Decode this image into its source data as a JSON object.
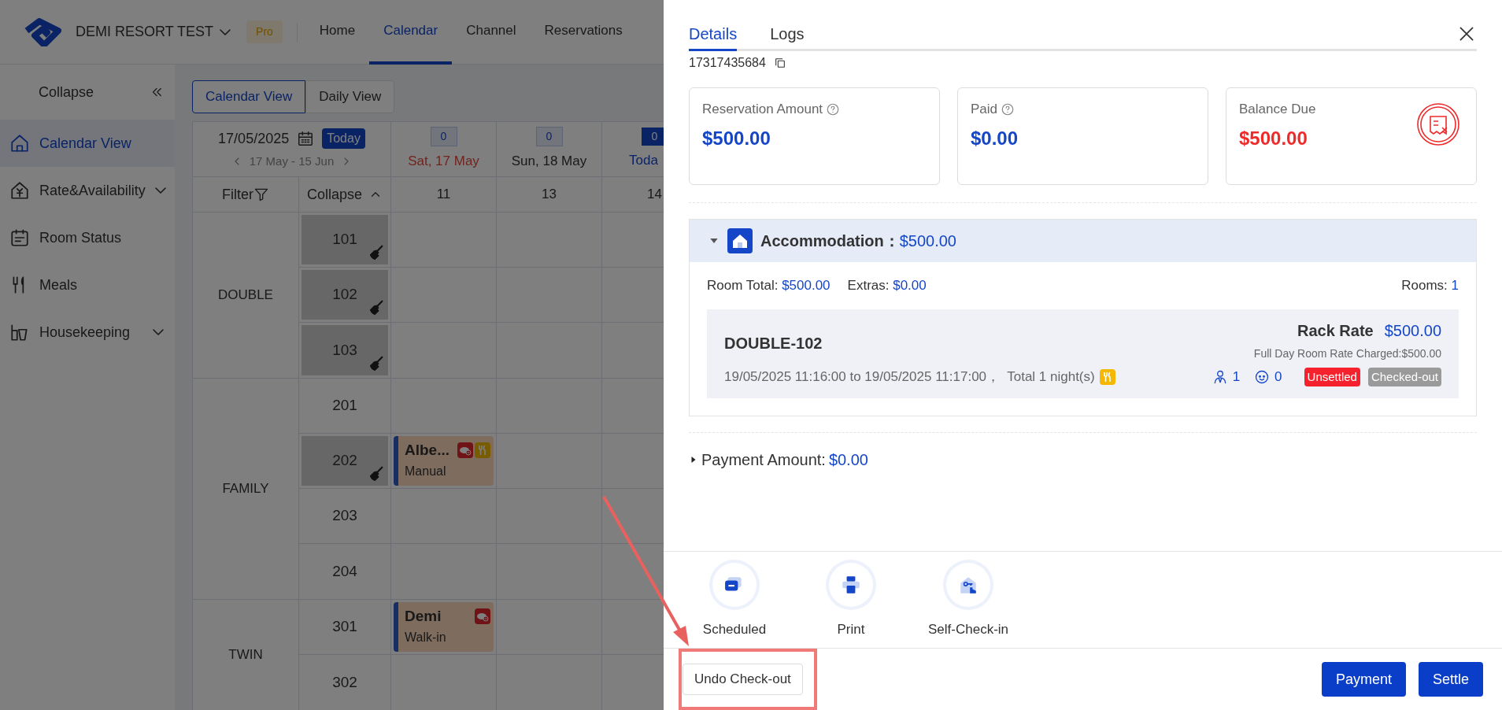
{
  "header": {
    "hotel": "DEMI RESORT TEST",
    "badge": "Pro",
    "nav": [
      {
        "label": "Home",
        "selected": false
      },
      {
        "label": "Calendar",
        "selected": true
      },
      {
        "label": "Channel",
        "selected": false
      },
      {
        "label": "Reservations",
        "selected": false
      }
    ]
  },
  "sidebar": {
    "collapse": "Collapse",
    "items": [
      {
        "label": "Calendar View",
        "selected": true
      },
      {
        "label": "Rate&Availability",
        "selected": false,
        "expandable": true
      },
      {
        "label": "Room Status",
        "selected": false
      },
      {
        "label": "Meals",
        "selected": false
      },
      {
        "label": "Housekeeping",
        "selected": false,
        "expandable": true
      }
    ]
  },
  "view_toggle": [
    {
      "label": "Calendar View",
      "selected": true
    },
    {
      "label": "Daily View",
      "selected": false
    }
  ],
  "calendar": {
    "date": "17/05/2025",
    "today": "Today",
    "range": "17 May - 15 Jun",
    "filter": "Filter",
    "collapse": "Collapse",
    "days": [
      {
        "count": "0",
        "label": "Sat, 17 May",
        "kind": "weekend",
        "available": "11"
      },
      {
        "count": "0",
        "label": "Sun, 18 May",
        "kind": "normal",
        "available": "13"
      },
      {
        "count": "0",
        "label": "Toda",
        "kind": "today",
        "available": "14"
      }
    ],
    "groups": [
      {
        "name": "DOUBLE",
        "rooms": [
          {
            "number": "101",
            "dirty": true
          },
          {
            "number": "102",
            "dirty": true
          },
          {
            "number": "103",
            "dirty": true
          }
        ]
      },
      {
        "name": "FAMILY",
        "rooms": [
          {
            "number": "201",
            "dirty": false
          },
          {
            "number": "202",
            "dirty": true,
            "booking": {
              "guest": "Albe...",
              "source": "Manual",
              "meal": true
            }
          },
          {
            "number": "203",
            "dirty": false
          },
          {
            "number": "204",
            "dirty": false
          }
        ]
      },
      {
        "name": "TWIN",
        "rooms": [
          {
            "number": "301",
            "dirty": false,
            "booking": {
              "guest": "Demi",
              "source": "Walk-in"
            }
          },
          {
            "number": "302",
            "dirty": false
          }
        ]
      }
    ]
  },
  "drawer": {
    "tabs": [
      {
        "label": "Details",
        "selected": true
      },
      {
        "label": "Logs",
        "selected": false
      }
    ],
    "phone": "17317435684",
    "cards": [
      {
        "label": "Reservation Amount",
        "help": true,
        "value": "$500.00",
        "kind": "amount"
      },
      {
        "label": "Paid",
        "help": true,
        "value": "$0.00",
        "kind": "amount"
      },
      {
        "label": "Balance Due",
        "value": "$500.00",
        "kind": "due"
      }
    ],
    "accommodation": {
      "title": "Accommodation：",
      "total": "$500.00",
      "expanded": true,
      "room_total_label": "Room Total:",
      "room_total": "$500.00",
      "extras_label": "Extras:",
      "extras": "$0.00",
      "rooms_label": "Rooms:",
      "rooms": "1",
      "room": {
        "name": "DOUBLE-102",
        "rate_label": "Rack Rate",
        "rate": "$500.00",
        "charged": "Full Day Room Rate Charged:$500.00",
        "dates": "19/05/2025 11:16:00 to 19/05/2025 11:17:00，  Total 1 night(s)",
        "adults": "1",
        "children": "0",
        "tags": [
          {
            "label": "Unsettled",
            "color": "#f5222d"
          },
          {
            "label": "Checked-out",
            "color": "#9a9a9a"
          }
        ]
      }
    },
    "payment": {
      "label": "Payment Amount:",
      "value": "$0.00",
      "expanded": false
    },
    "actions": [
      {
        "label": "Scheduled"
      },
      {
        "label": "Print"
      },
      {
        "label": "Self-Check-in"
      }
    ],
    "footer": {
      "undo": "Undo Check-out",
      "buttons": [
        "Payment",
        "Settle"
      ]
    }
  }
}
